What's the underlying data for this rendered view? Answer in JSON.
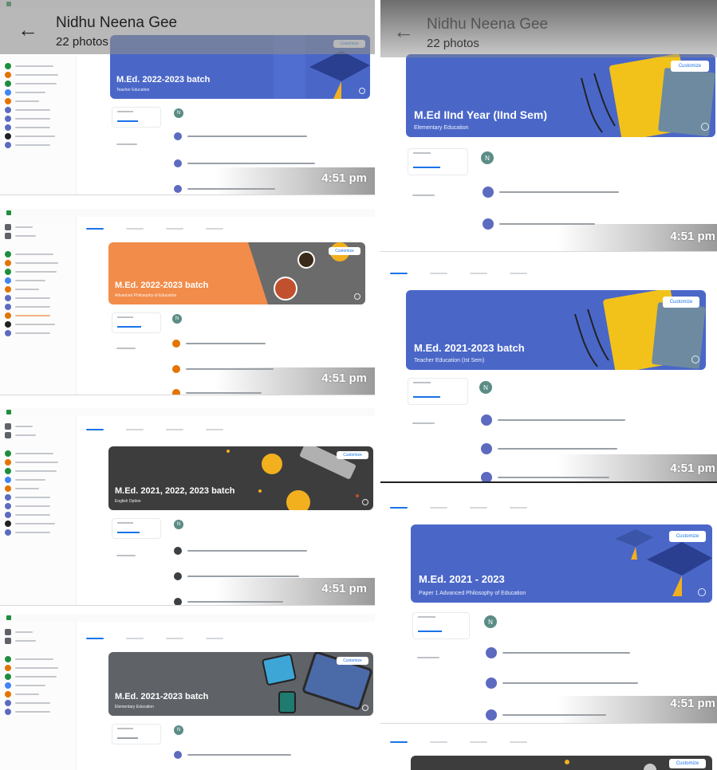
{
  "album": {
    "title": "Nidhu Neena Gee",
    "photo_count": "22 photos",
    "back_icon": "arrow-back-icon"
  },
  "classroom": {
    "customize_label": "Customize",
    "time_label": "4:51 pm",
    "avatar_initial": "N"
  },
  "left_screens": [
    {
      "banner_title": "M.Ed. 2022-2023 batch",
      "banner_subtitle": "Teacher Education",
      "theme": "blue-graduation",
      "banner_color": "#4a67c8"
    },
    {
      "banner_title": "M.Ed. 2022-2023 batch",
      "banner_subtitle": "Advanced Philosophy of Education",
      "theme": "orange-coffee",
      "banner_color": "#f28c4a"
    },
    {
      "banner_title": "M.Ed. 2021, 2022, 2023 batch",
      "banner_subtitle": "English Option",
      "theme": "dark-lanterns",
      "banner_color": "#3d3d3d"
    },
    {
      "banner_title": "M.Ed. 2021-2023 batch",
      "banner_subtitle": "Elementary Education",
      "theme": "grey-devices",
      "banner_color": "#5f6368"
    }
  ],
  "right_screens": [
    {
      "banner_title": "M.Ed IInd Year (IInd Sem)",
      "banner_subtitle": "Elementary Education",
      "theme": "blue-books",
      "banner_color": "#4a67c8"
    },
    {
      "banner_title": "M.Ed. 2021-2023 batch",
      "banner_subtitle": "Teacher Education (Ist Sem)",
      "theme": "blue-books",
      "banner_color": "#4a67c8"
    },
    {
      "banner_title": "M.Ed. 2021 - 2023",
      "banner_subtitle": "Paper 1 Advanced Philosophy of Education",
      "theme": "blue-graduation",
      "banner_color": "#4a67c8"
    }
  ],
  "colors": {
    "accent": "#1a73e8",
    "classroom_green": "#1e8e3e",
    "sidebar_avatar_palette": [
      "#1e8e3e",
      "#e37400",
      "#1e8e3e",
      "#4285f4",
      "#e37400",
      "#5c6bc0",
      "#5c6bc0",
      "#5c6bc0",
      "#202124",
      "#5c6bc0"
    ]
  }
}
